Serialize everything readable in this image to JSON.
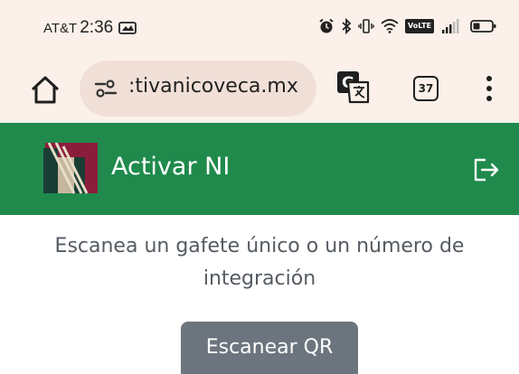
{
  "status_bar": {
    "carrier": "AT&T",
    "time": "2:36",
    "volte_label": "VoLTE"
  },
  "browser": {
    "url": ":tivanicoveca.mx",
    "tab_count": "37",
    "icons": [
      "home-icon",
      "site-settings-icon",
      "translate-icon",
      "tab-switcher-icon",
      "more-menu-icon"
    ]
  },
  "app_header": {
    "title": "Activar NI",
    "background_color": "#1f8a4c",
    "icons": [
      "logo",
      "logout-icon"
    ]
  },
  "content": {
    "instruction": "Escanea un gafete único o un número de integración",
    "scan_button_label": "Escanear QR",
    "button_color": "#6c757d"
  }
}
